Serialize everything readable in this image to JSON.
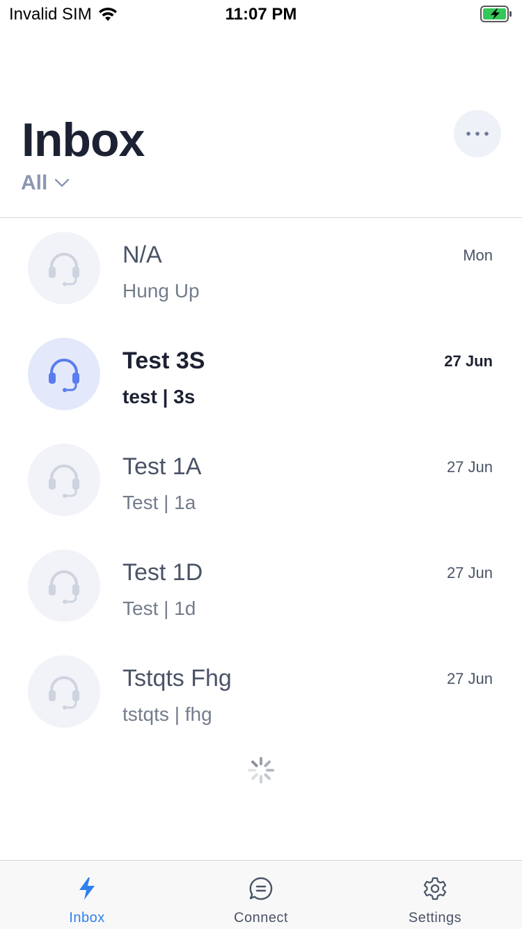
{
  "status_bar": {
    "carrier": "Invalid SIM",
    "time": "11:07 PM",
    "battery_color": "#34c759"
  },
  "header": {
    "title": "Inbox",
    "filter_label": "All"
  },
  "conversations": [
    {
      "title": "N/A",
      "subtitle": "Hung Up",
      "date": "Mon",
      "unread": false,
      "icon": "headset-icon"
    },
    {
      "title": "Test 3S",
      "subtitle": "test | 3s",
      "date": "27 Jun",
      "unread": true,
      "icon": "headset-icon"
    },
    {
      "title": "Test 1A",
      "subtitle": "Test | 1a",
      "date": "27 Jun",
      "unread": false,
      "icon": "headset-icon"
    },
    {
      "title": "Test 1D",
      "subtitle": "Test | 1d",
      "date": "27 Jun",
      "unread": false,
      "icon": "headset-icon"
    },
    {
      "title": "Tstqts Fhg",
      "subtitle": "tstqts | fhg",
      "date": "27 Jun",
      "unread": false,
      "icon": "headset-icon"
    }
  ],
  "tabs": [
    {
      "label": "Inbox",
      "icon": "lightning-icon",
      "active": true
    },
    {
      "label": "Connect",
      "icon": "chat-bubble-icon",
      "active": false
    },
    {
      "label": "Settings",
      "icon": "gear-icon",
      "active": false
    }
  ],
  "colors": {
    "accent": "#2f80ed",
    "active_headset": "#5b7cef",
    "inactive_headset": "#cdd3df"
  }
}
